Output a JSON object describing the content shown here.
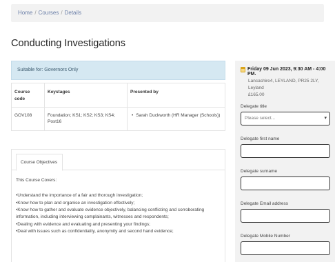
{
  "breadcrumb": {
    "home": "Home",
    "courses": "Courses",
    "details": "Details",
    "sep": "/"
  },
  "page_title": "Conducting Investigations",
  "suitability": "Suitable for: Governors Only",
  "course_table": {
    "headers": [
      "Course code",
      "Keystages",
      "Presented by"
    ],
    "row": {
      "code": "GOV108",
      "keystages": "Foundation; KS1; KS2; KS3; KS4; Post16",
      "presenters": [
        "Sarah Duckworth (HR Manager (Schools))"
      ]
    }
  },
  "tabs": [
    {
      "label": "Course Objectives"
    }
  ],
  "objectives": {
    "intro": "This Course Covers:",
    "items": [
      "Understand the importance of a fair and thorough investigation;",
      "Know how to plan and organise an investigation effectively;",
      "Know how to gather and evaluate evidence objectively, balancing conflicting and corroborating information, including interviewing complainants, witnesses and respondents;",
      "Dealing with evidence and evaluating and presenting your findings;",
      "Deal with issues such as confidentiality, anonymity and second hand evidence;"
    ]
  },
  "booking": {
    "date": "Friday 09 Jun 2023, 9:30 AM - 4:00 PM.",
    "venue_lines": [
      "Lancashire4, LEYLAND, PR25 2LY,",
      "Leyland"
    ],
    "price": "£165.00",
    "fields": {
      "title_label": "Delegate title",
      "title_value": "Please select...",
      "first_name_label": "Delegate first name",
      "surname_label": "Delegate surname",
      "email_label": "Delegate Email address",
      "mobile_label": "Delegate Mobile Number"
    }
  },
  "colors": {
    "info_bg": "#d5e8f2",
    "sidebar_bg": "#f2f2f2",
    "link": "#6b7fa8",
    "calendar": "#d9a41b"
  }
}
